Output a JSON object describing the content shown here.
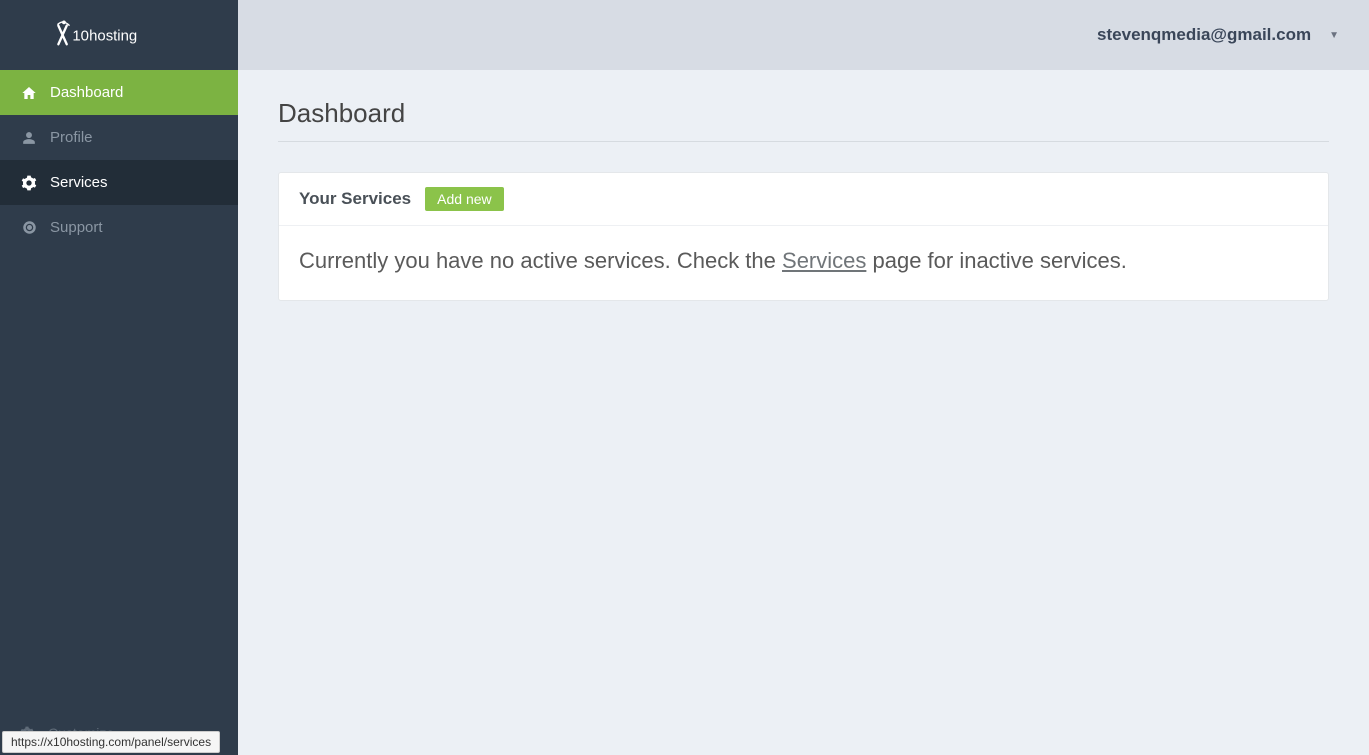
{
  "brand": "x10hosting",
  "sidebar": {
    "items": [
      {
        "label": "Dashboard"
      },
      {
        "label": "Profile"
      },
      {
        "label": "Services"
      },
      {
        "label": "Support"
      }
    ],
    "footer_label": "Customize"
  },
  "header": {
    "user_email": "stevenqmedia@gmail.com"
  },
  "page": {
    "title": "Dashboard"
  },
  "services_panel": {
    "title": "Your Services",
    "add_button": "Add new",
    "empty_prefix": "Currently you have no active services. Check the ",
    "empty_link": "Services",
    "empty_suffix": " page for inactive services."
  },
  "status_bar": "https://x10hosting.com/panel/services"
}
